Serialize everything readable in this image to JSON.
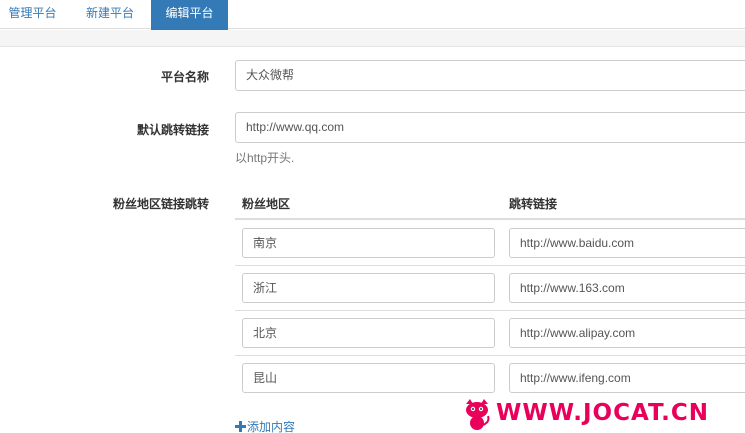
{
  "tabs": [
    {
      "label": "管理平台",
      "active": false
    },
    {
      "label": "新建平台",
      "active": false
    },
    {
      "label": "编辑平台",
      "active": true
    }
  ],
  "form": {
    "name": {
      "label": "平台名称",
      "value": "大众微帮"
    },
    "default_link": {
      "label": "默认跳转链接",
      "value": "http://www.qq.com",
      "help": "以http开头."
    },
    "region_links": {
      "label": "粉丝地区链接跳转",
      "columns": [
        "粉丝地区",
        "跳转链接"
      ],
      "rows": [
        {
          "region": "南京",
          "url": "http://www.baidu.com"
        },
        {
          "region": "浙江",
          "url": "http://www.163.com"
        },
        {
          "region": "北京",
          "url": "http://www.alipay.com"
        },
        {
          "region": "昆山",
          "url": "http://www.ifeng.com"
        }
      ],
      "add_label": "添加内容"
    }
  },
  "watermark": {
    "text": "WWW.JOCAT.CN",
    "icon": "cat-logo-icon"
  },
  "colors": {
    "accent": "#337ab7",
    "watermark": "#e8005a"
  }
}
